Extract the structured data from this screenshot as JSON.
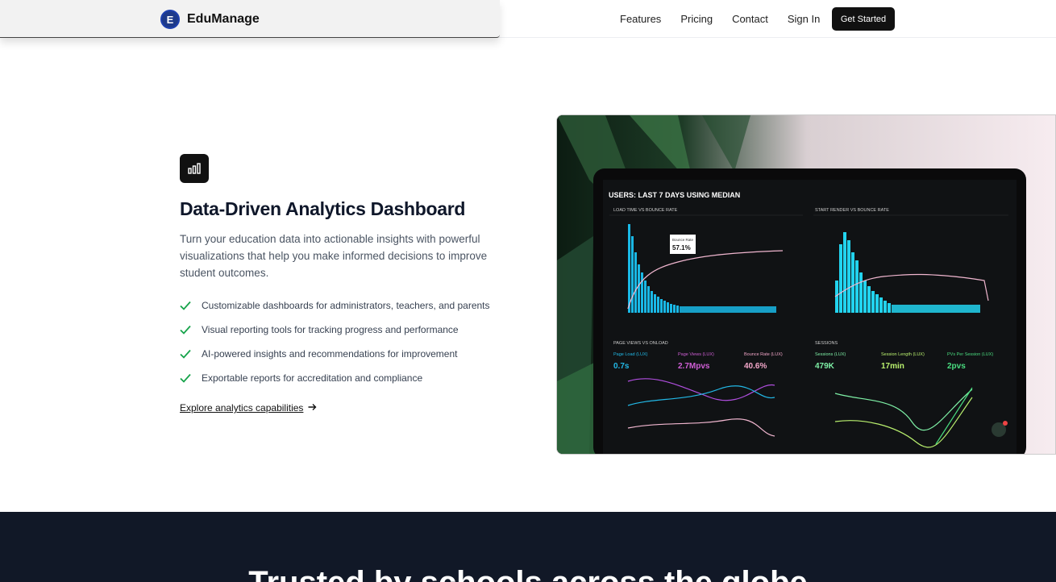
{
  "header": {
    "logo_letter": "E",
    "brand": "EduManage",
    "nav": [
      "Features",
      "Pricing",
      "Contact",
      "Sign In"
    ],
    "cta": "Get Started"
  },
  "feature": {
    "icon": "bar-chart-icon",
    "title": "Data-Driven Analytics Dashboard",
    "description": "Turn your education data into actionable insights with powerful visualizations that help you make informed decisions to improve student outcomes.",
    "bullets": [
      "Customizable dashboards for administrators, teachers, and parents",
      "Visual reporting tools for tracking progress and performance",
      "AI-powered insights and recommendations for improvement",
      "Exportable reports for accreditation and compliance"
    ],
    "link": "Explore analytics capabilities"
  },
  "image": {
    "screen_title": "USERS: LAST 7 DAYS USING MEDIAN",
    "panels": {
      "p1": "LOAD TIME VS BOUNCE RATE",
      "p2": "START RENDER VS BOUNCE RATE",
      "p3": "PAGE VIEWS VS ONLOAD",
      "p4": "SESSIONS"
    },
    "tooltip_label": "Bounce Rate",
    "tooltip_value": "57.1%",
    "stats": [
      {
        "label": "Page Load (LUX)",
        "value": "0.7s",
        "color": "#22b8e6"
      },
      {
        "label": "Page Views (LUX)",
        "value": "2.7Mpvs",
        "color": "#d05fd6"
      },
      {
        "label": "Bounce Rate (LUX)",
        "value": "40.6%",
        "color": "#f3a6c9"
      },
      {
        "label": "Sessions (LUX)",
        "value": "479K",
        "color": "#7ef0a6"
      },
      {
        "label": "Session Length (LUX)",
        "value": "17min",
        "color": "#b9f06e"
      },
      {
        "label": "PVs Per Session (LUX)",
        "value": "2pvs",
        "color": "#4ade80"
      }
    ]
  },
  "dark_section": {
    "heading": "Trusted by schools across the globe"
  }
}
